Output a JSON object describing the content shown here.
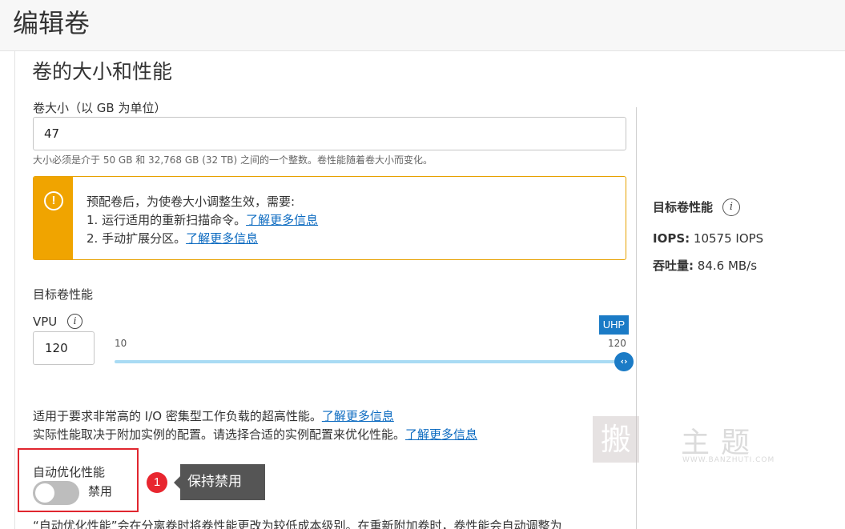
{
  "page_title": "编辑卷",
  "section_title": "卷的大小和性能",
  "size": {
    "label": "卷大小（以 GB 为单位）",
    "value": "47",
    "help": "大小必须是介于 50 GB 和 32,768 GB (32 TB) 之间的一个整数。卷性能随着卷大小而变化。"
  },
  "warning": {
    "icon": "exclamation-circle-icon",
    "color": "#f0a400",
    "line1": "预配卷后，为使卷大小调整生效，需要:",
    "line2_prefix": "1. 运行适用的重新扫描命令。",
    "line2_link": "了解更多信息",
    "line3_prefix": "2. 手动扩展分区。",
    "line3_link": "了解更多信息"
  },
  "target_perf": {
    "label": "目标卷性能",
    "vpu_label": "VPU",
    "vpu_value": "120",
    "slider_min": "10",
    "slider_max": "120",
    "slider_badge": "UHP",
    "slider_value_fraction": 1.0
  },
  "description": {
    "line1_prefix": "适用于要求非常高的 I/O 密集型工作负载的超高性能。",
    "line1_link": "了解更多信息",
    "line2_prefix": "实际性能取决于附加实例的配置。请选择合适的实例配置来优化性能。",
    "line2_link": "了解更多信息"
  },
  "auto_tune": {
    "label": "自动优化性能",
    "state": "禁用",
    "enabled": false
  },
  "annotation": {
    "badge": "1",
    "callout": "保持禁用"
  },
  "bottom_text": "“自动优化性能”会在分离卷时将卷性能更改为较低成本级别。在重新附加卷时，卷性能会自动调整为",
  "side_panel": {
    "title": "目标卷性能",
    "iops_label": "IOPS:",
    "iops_value": "10575 IOPS",
    "throughput_label": "吞吐量:",
    "throughput_value": "84.6 MB/s"
  },
  "watermark": {
    "seal_char": "搬",
    "text": "主题",
    "url": "WWW.BANZHUTI.COM"
  }
}
